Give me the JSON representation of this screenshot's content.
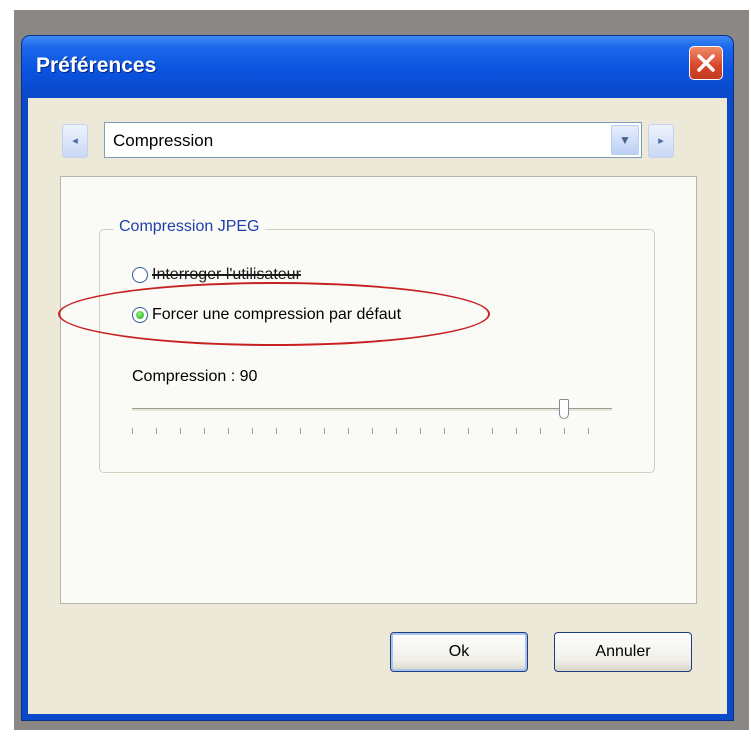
{
  "window": {
    "title": "Préférences",
    "close_icon": "close-x-icon"
  },
  "navigation": {
    "prev_icon": "chevron-left-icon",
    "next_icon": "chevron-right-icon",
    "category_select": {
      "value": "Compression",
      "dropdown_icon": "chevron-down-icon"
    }
  },
  "panel": {
    "group_title": "Compression JPEG",
    "options": [
      {
        "label": "Interroger l'utilisateur",
        "selected": false
      },
      {
        "label": "Forcer une compression par défaut",
        "selected": true
      }
    ],
    "slider": {
      "label": "Compression : 90",
      "value": 90,
      "min": 0,
      "max": 100
    }
  },
  "annotation": {
    "highlight_color": "#c72020"
  },
  "buttons": {
    "ok": "Ok",
    "cancel": "Annuler"
  },
  "colors": {
    "titlebar": "#0a53e0",
    "window_bg": "#ece9d8",
    "radio_checked": "#22a516"
  }
}
